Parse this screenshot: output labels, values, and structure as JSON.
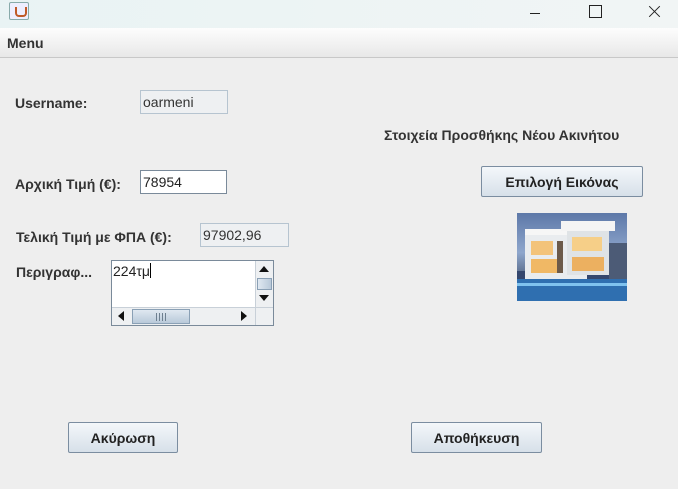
{
  "window": {
    "controls": [
      "minimize",
      "maximize",
      "close"
    ]
  },
  "menubar": {
    "menu_label": "Menu"
  },
  "form": {
    "username_label": "Username:",
    "username_value": "oarmeni",
    "section_title": "Στοιχεία Προσθήκης Νέου Ακινήτου",
    "initial_price_label": "Αρχική Τιμή (€):",
    "initial_price_value": "78954",
    "final_price_label": "Τελική Τιμή με ΦΠΑ (€):",
    "final_price_value": "97902,96",
    "description_label": "Περιγραφ...",
    "description_value": "224τμ",
    "select_image_label": "Επιλογή Εικόνας",
    "cancel_label": "Ακύρωση",
    "save_label": "Αποθήκευση"
  },
  "icons": {
    "app": "java-cup-icon",
    "image": "house-photo"
  }
}
